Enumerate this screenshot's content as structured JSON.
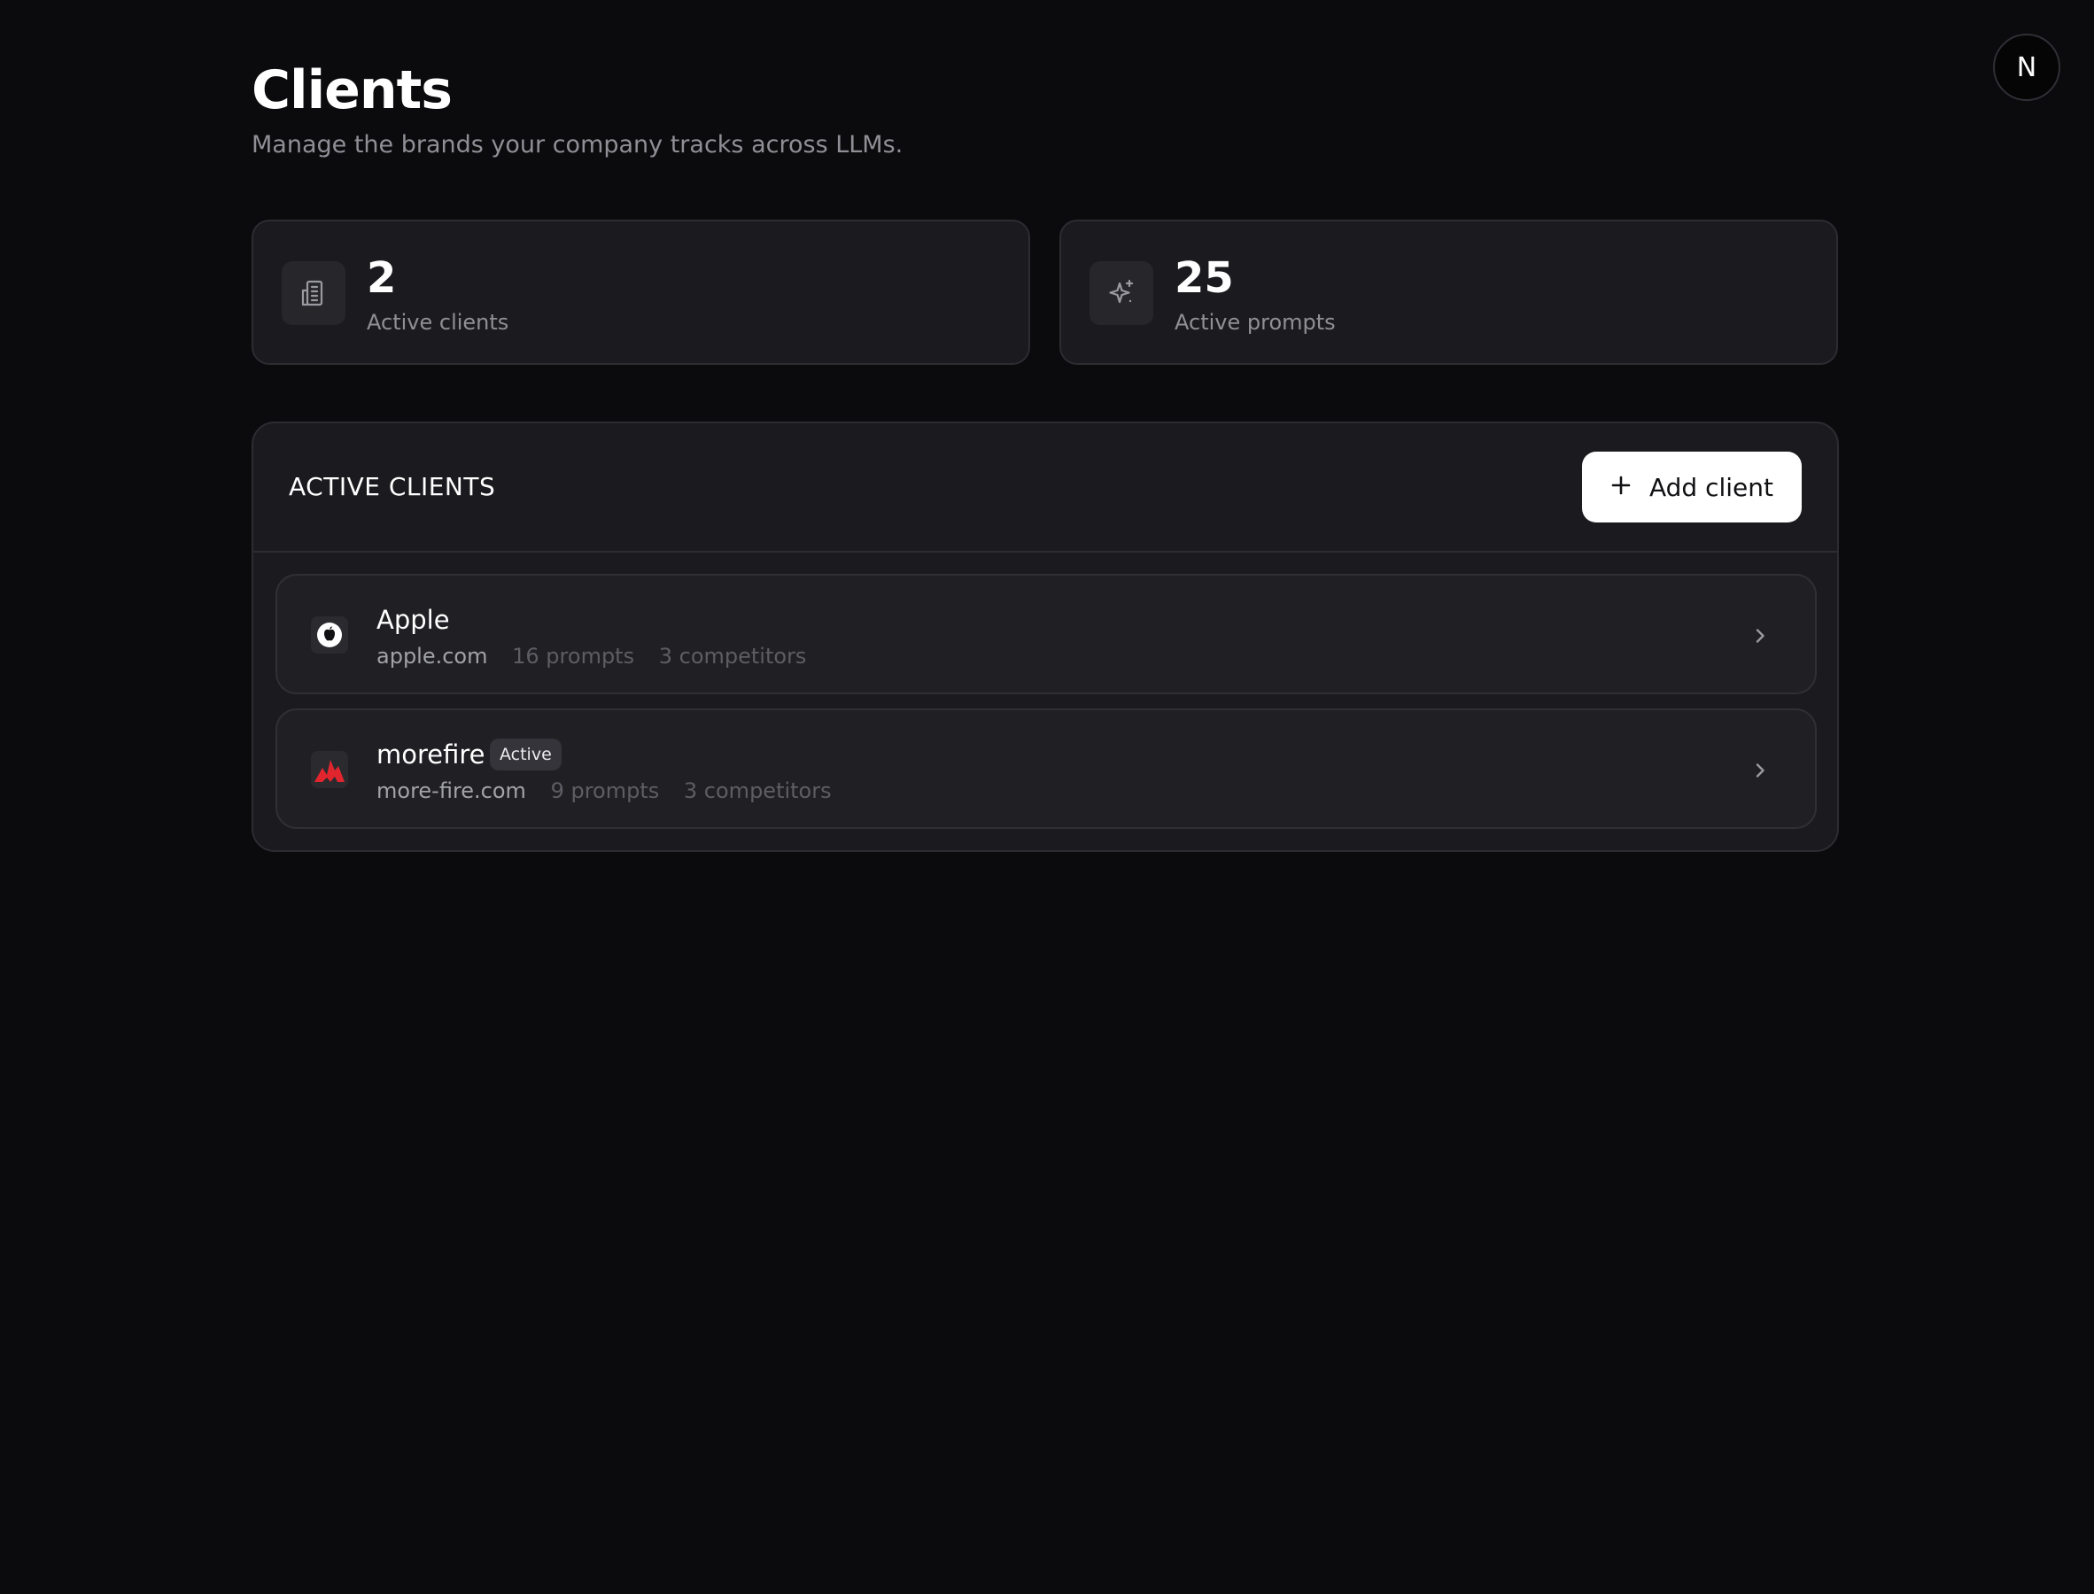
{
  "header": {
    "title": "Clients",
    "subtitle": "Manage the brands your company tracks across LLMs."
  },
  "user_avatar": {
    "initial": "N"
  },
  "stats": [
    {
      "value": "2",
      "label": "Active clients",
      "icon": "building-icon"
    },
    {
      "value": "25",
      "label": "Active prompts",
      "icon": "sparkles-icon"
    }
  ],
  "clients_panel": {
    "heading": "ACTIVE CLIENTS",
    "add_button_label": "Add client",
    "clients": [
      {
        "name": "Apple",
        "domain": "apple.com",
        "prompts": "16 prompts",
        "competitors": "3 competitors",
        "logo_icon": "apple-logo-icon"
      },
      {
        "name": "morefire",
        "badge": "Active",
        "domain": "more-fire.com",
        "prompts": "9 prompts",
        "competitors": "3 competitors",
        "logo_icon": "morefire-logo-icon",
        "logo_color": "#e1252e"
      }
    ]
  },
  "colors": {
    "background": "#0b0b0d",
    "card": "#1b1b1f",
    "border": "#2c2c31",
    "muted_text": "#8f8f96",
    "primary_button": "#ffffff"
  }
}
